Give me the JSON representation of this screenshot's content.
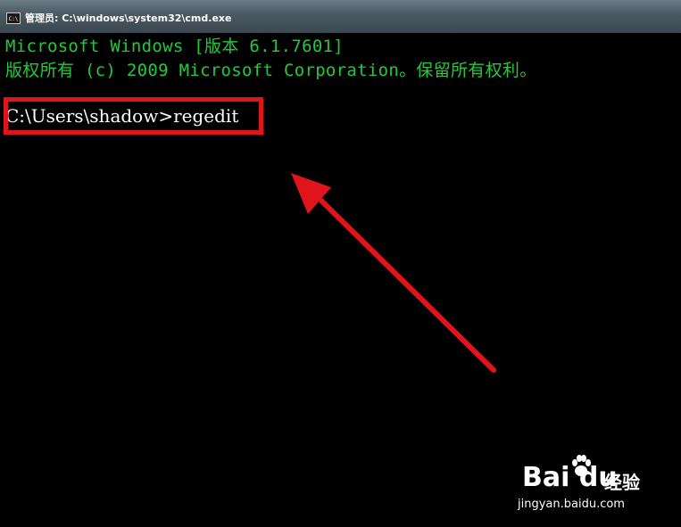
{
  "window": {
    "icon_text": "C:\\",
    "title": "管理员: C:\\windows\\system32\\cmd.exe"
  },
  "console": {
    "line1": "Microsoft Windows [版本 6.1.7601]",
    "line2": "版权所有 (c) 2009 Microsoft Corporation。保留所有权利。",
    "prompt": "C:\\Users\\shadow>",
    "command": "regedit"
  },
  "watermark": {
    "logo_text": "Bai du",
    "cn_text": "经验",
    "url": "jingyan.baidu.com"
  },
  "colors": {
    "console_text": "#22c93a",
    "annotation": "#e0141b"
  }
}
